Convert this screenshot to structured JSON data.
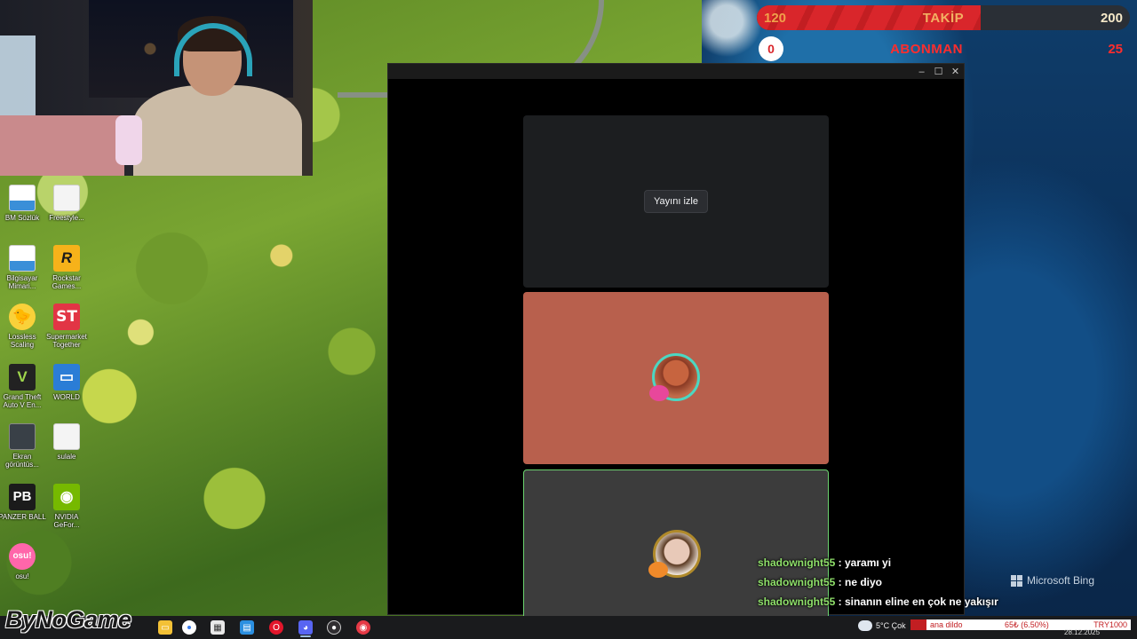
{
  "counters": {
    "follow": {
      "current": "120",
      "label": "TAKİP",
      "goal": "200",
      "progress": 0.6
    },
    "subscribe": {
      "current": "0",
      "label": "ABONMAN",
      "goal": "25",
      "progress": 0
    }
  },
  "desktop_icons": [
    {
      "id": "bm-sozluk",
      "label": "BM Sözlük",
      "icon": "document-icon"
    },
    {
      "id": "freestyle",
      "label": "Freestyle...",
      "icon": "document-icon"
    },
    {
      "id": "bilgisayar",
      "label": "Bilgisayar Mimari...",
      "icon": "document-icon"
    },
    {
      "id": "rockstar",
      "label": "Rockstar Games...",
      "glyph": "R",
      "icon": "rockstar-icon"
    },
    {
      "id": "lossless",
      "label": "Lossless Scaling",
      "glyph": "🐤",
      "icon": "lossless-scaling-icon"
    },
    {
      "id": "supermarket",
      "label": "Supermarket Together",
      "glyph": "ST",
      "icon": "supermarket-together-icon"
    },
    {
      "id": "gta",
      "label": "Grand Theft Auto V En...",
      "glyph": "V",
      "icon": "gta-icon"
    },
    {
      "id": "world",
      "label": "WORLD",
      "glyph": "▭",
      "icon": "world-icon"
    },
    {
      "id": "ekran",
      "label": "Ekran görüntüs...",
      "icon": "screenshot-icon"
    },
    {
      "id": "sulale",
      "label": "sulale",
      "icon": "document-icon"
    },
    {
      "id": "panzer",
      "label": "PANZER BALL",
      "glyph": "PB",
      "icon": "panzer-ball-icon"
    },
    {
      "id": "nvidia",
      "label": "NVIDIA GeFor...",
      "glyph": "◉",
      "icon": "nvidia-icon"
    },
    {
      "id": "osu",
      "label": "osu!",
      "glyph": "osu!",
      "icon": "osu-icon"
    }
  ],
  "window": {
    "controls": {
      "minimize": "–",
      "maximize": "☐",
      "close": "✕"
    },
    "watch_button": "Yayını izle"
  },
  "chat": [
    {
      "user": "shadownight55",
      "message": " : yaramı yi"
    },
    {
      "user": "shadownight55",
      "message": " : ne diyo"
    },
    {
      "user": "shadownight55",
      "message": " : sinanın eline en çok ne yakışır"
    }
  ],
  "bing": {
    "label": "Microsoft Bing"
  },
  "brand": {
    "text": "ByNoGame"
  },
  "taskbar": {
    "apps": [
      "file-explorer-icon",
      "terminal-icon",
      "chrome-icon",
      "store-icon",
      "calculator-icon",
      "opera-gx-icon",
      "discord-icon",
      "obs-icon",
      "chrome-profile-icon"
    ],
    "weather": "5°C  Çok",
    "ticker": {
      "t1": "ana dildo",
      "t2": "65₺ (6.50%)",
      "t3": "TRY1000"
    },
    "date": "28.12.2025"
  },
  "colors": {
    "follow_bar": "#d9262b",
    "sub_label": "#ff2d2d",
    "chat_user": "#8fe06a",
    "tile_user1": "#b8604d",
    "tile_user2": "#3c3c3c",
    "speaking_border": "#6bd36f"
  }
}
